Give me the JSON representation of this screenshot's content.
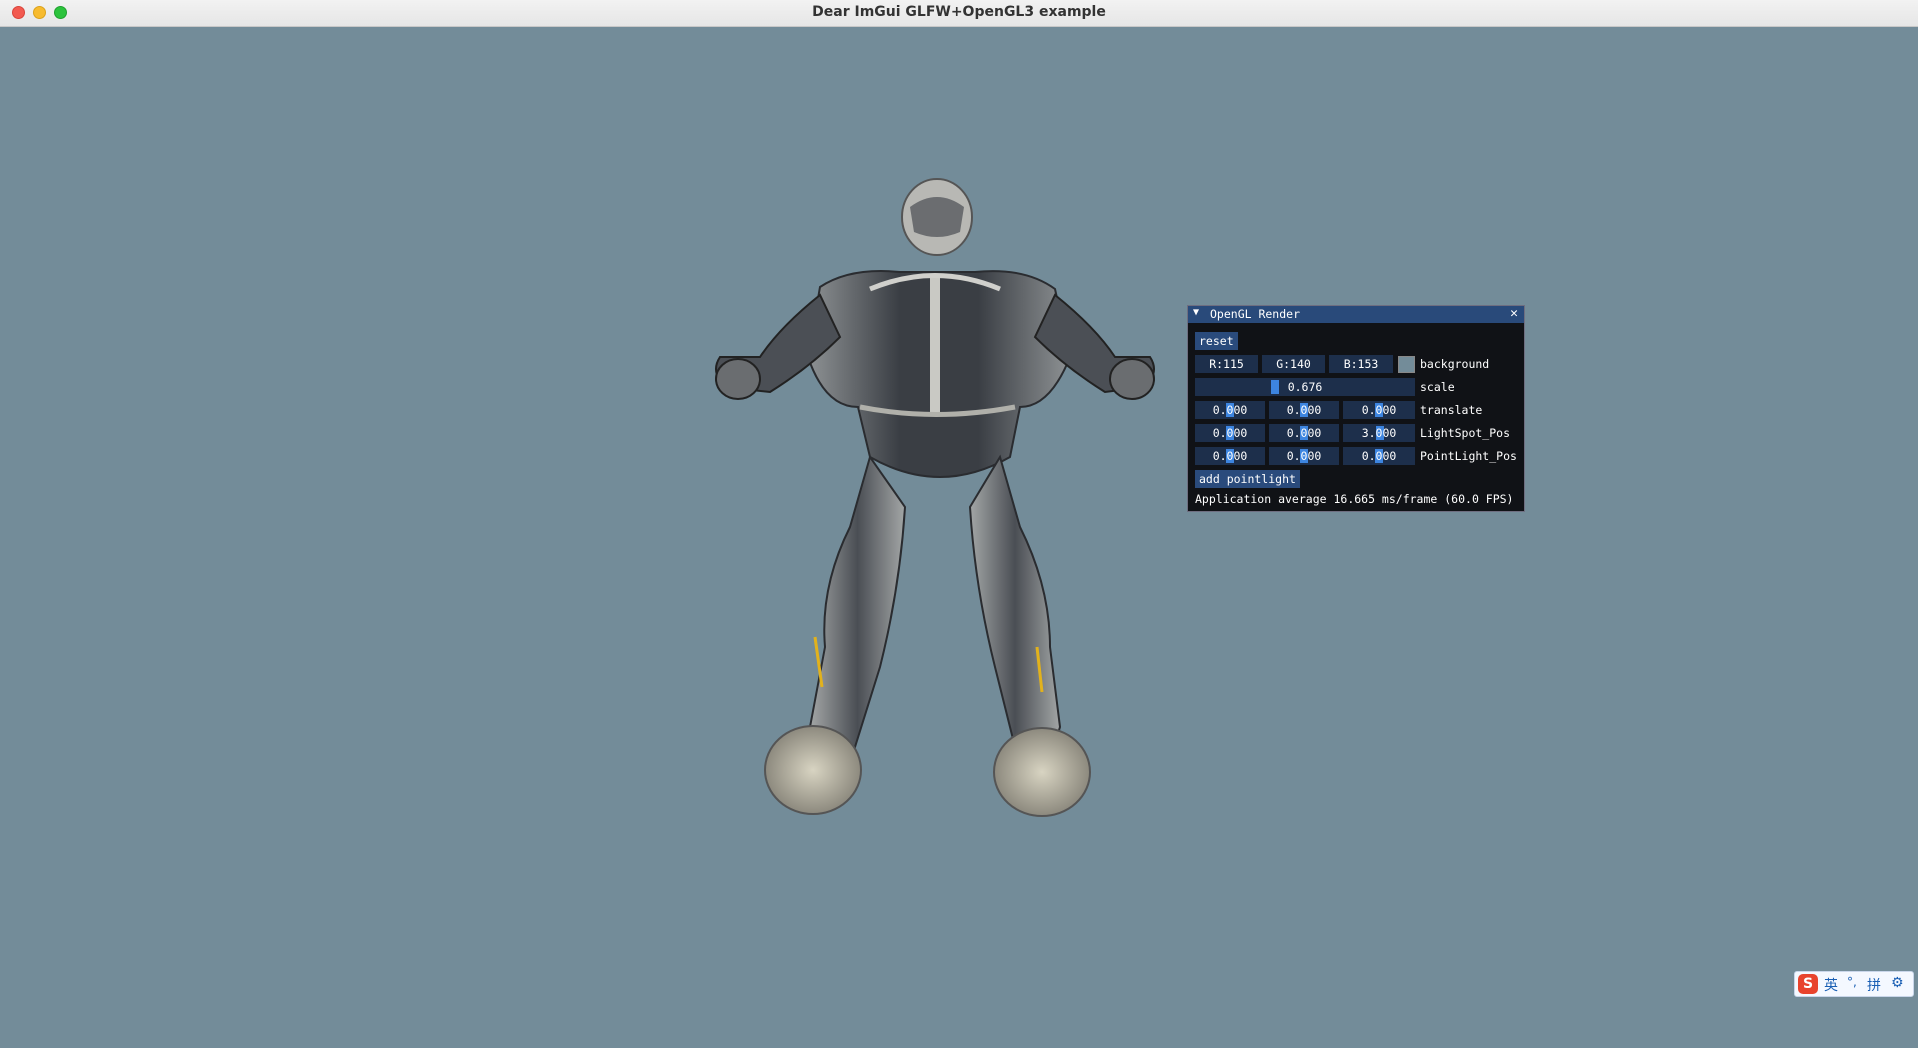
{
  "window": {
    "title": "Dear ImGui GLFW+OpenGL3 example"
  },
  "panel": {
    "title": "OpenGL Render",
    "reset_label": "reset",
    "background": {
      "r": "R:115",
      "g": "G:140",
      "b": "B:153",
      "label": "background",
      "color": "#738c99"
    },
    "scale": {
      "value": "0.676",
      "label": "scale"
    },
    "translate": {
      "x": "0.000",
      "y": "0.000",
      "z": "0.000",
      "label": "translate"
    },
    "lightspot": {
      "x": "0.000",
      "y": "0.000",
      "z": "3.000",
      "label": "LightSpot_Pos"
    },
    "pointlight": {
      "x": "0.000",
      "y": "0.000",
      "z": "0.000",
      "label": "PointLight_Pos"
    },
    "add_pointlight_label": "add pointlight",
    "fps_text": "Application average 16.665 ms/frame (60.0 FPS)"
  },
  "ime": {
    "lang": "英",
    "mode": "拼"
  }
}
